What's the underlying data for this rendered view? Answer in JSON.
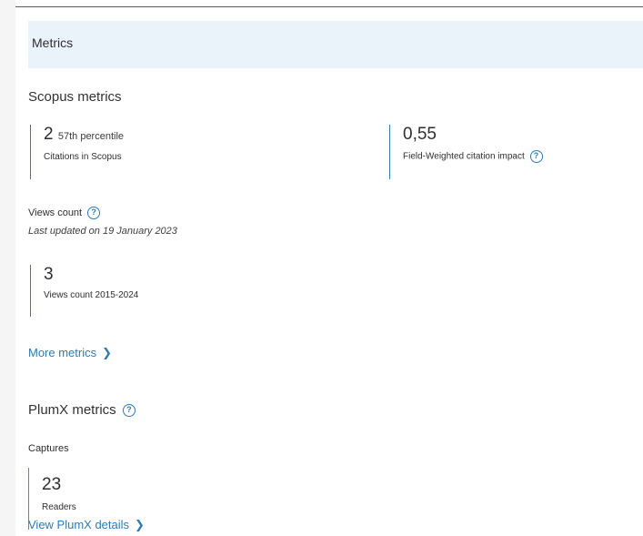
{
  "header": {
    "title": "Metrics"
  },
  "scopus": {
    "title": "Scopus metrics",
    "citations": {
      "value": "2",
      "percentile": "57th percentile",
      "label": "Citations in Scopus"
    },
    "fwci": {
      "value": "0,55",
      "label": "Field-Weighted citation impact"
    }
  },
  "views": {
    "title": "Views count",
    "updated": "Last updated on 19 January 2023",
    "value": "3",
    "label": "Views count 2015-2024"
  },
  "more_metrics": {
    "label": "More metrics"
  },
  "plumx": {
    "title": "PlumX metrics",
    "captures_title": "Captures",
    "readers": {
      "value": "23",
      "label": "Readers"
    },
    "details_link": "View PlumX details"
  },
  "colors": {
    "accent_blue": "#2e7bb4",
    "plumx_magenta": "#c44fc4",
    "header_bg": "#ebf3fa"
  },
  "icons": {
    "help": "question-circle-icon",
    "chevron": "chevron-right-icon"
  }
}
